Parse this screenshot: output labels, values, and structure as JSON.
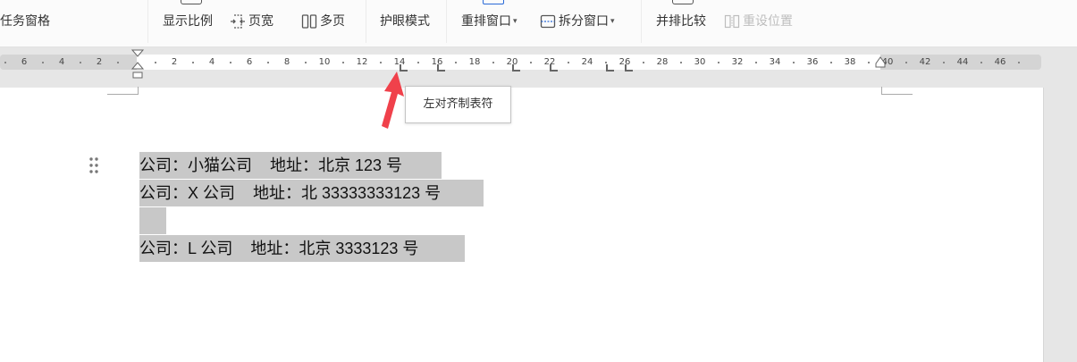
{
  "toolbar": {
    "task_pane": "任务窗格",
    "zoom_ratio": "显示比例",
    "page_width": "页宽",
    "multi_page": "多页",
    "eye_mode": "护眼模式",
    "rearrange_window": "重排窗口",
    "split_window": "拆分窗口",
    "side_by_side": "并排比较",
    "reset_position": "重设位置"
  },
  "ruler": {
    "labels": [
      "6",
      "4",
      "2",
      "2",
      "4",
      "6",
      "8",
      "10",
      "12",
      "14",
      "16",
      "18",
      "20",
      "22",
      "24",
      "26",
      "28",
      "30",
      "32",
      "34",
      "36",
      "38",
      "40",
      "42",
      "44",
      "46"
    ]
  },
  "tooltip": {
    "text": "左对齐制表符"
  },
  "document": {
    "lines": [
      "公司：小猫公司    地址：北京 123 号 ",
      "公司：X 公司    地址：北 33333333123 号 ",
      "公司：L 公司    地址：北京 3333123 号 "
    ]
  },
  "colors": {
    "selection": "#c8c8c8",
    "arrow": "#f0414b"
  }
}
